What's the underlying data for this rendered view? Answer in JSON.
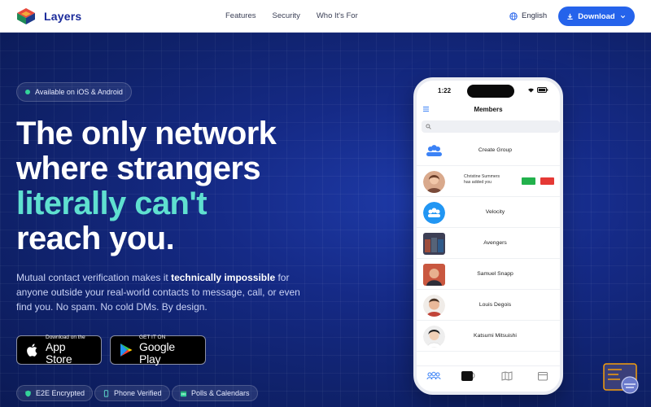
{
  "brand": {
    "name": "Layers"
  },
  "nav": {
    "links": [
      "Features",
      "Security",
      "Who It's For"
    ],
    "language": "English",
    "download": "Download"
  },
  "hero": {
    "badge": "Available on iOS & Android",
    "headline": {
      "line1": "The only network",
      "line2": "where strangers",
      "line3_accent": "literally can't",
      "line4": "reach you."
    },
    "subtitle": {
      "pre": "Mutual contact verification makes it ",
      "bold": "technically impossible",
      "post": " for anyone outside your real-world contacts to message, call, or even find you. No spam. No cold DMs. By design."
    },
    "stores": {
      "apple": {
        "small": "Download on the",
        "big": "App Store"
      },
      "google": {
        "small": "GET IT ON",
        "big": "Google Play"
      }
    },
    "features": [
      "E2E Encrypted",
      "Phone Verified",
      "Polls & Calendars"
    ]
  },
  "phone": {
    "time": "1:22",
    "title": "Members",
    "rows": [
      {
        "name": "Create Group",
        "kind": "group"
      },
      {
        "name": "Christine Summers",
        "note": "has added you",
        "kind": "request"
      },
      {
        "name": "Velocity",
        "kind": "group2"
      },
      {
        "name": "Avengers",
        "kind": "photo"
      },
      {
        "name": "Samuel Snapp",
        "kind": "photo"
      },
      {
        "name": "Louis Degois",
        "kind": "photo"
      },
      {
        "name": "Katsumi Mitsuishi",
        "kind": "photo"
      }
    ]
  },
  "colors": {
    "accent": "#5fe0d0",
    "brand": "#2563eb",
    "heroBg": "#152a86",
    "online": "#34d399"
  }
}
